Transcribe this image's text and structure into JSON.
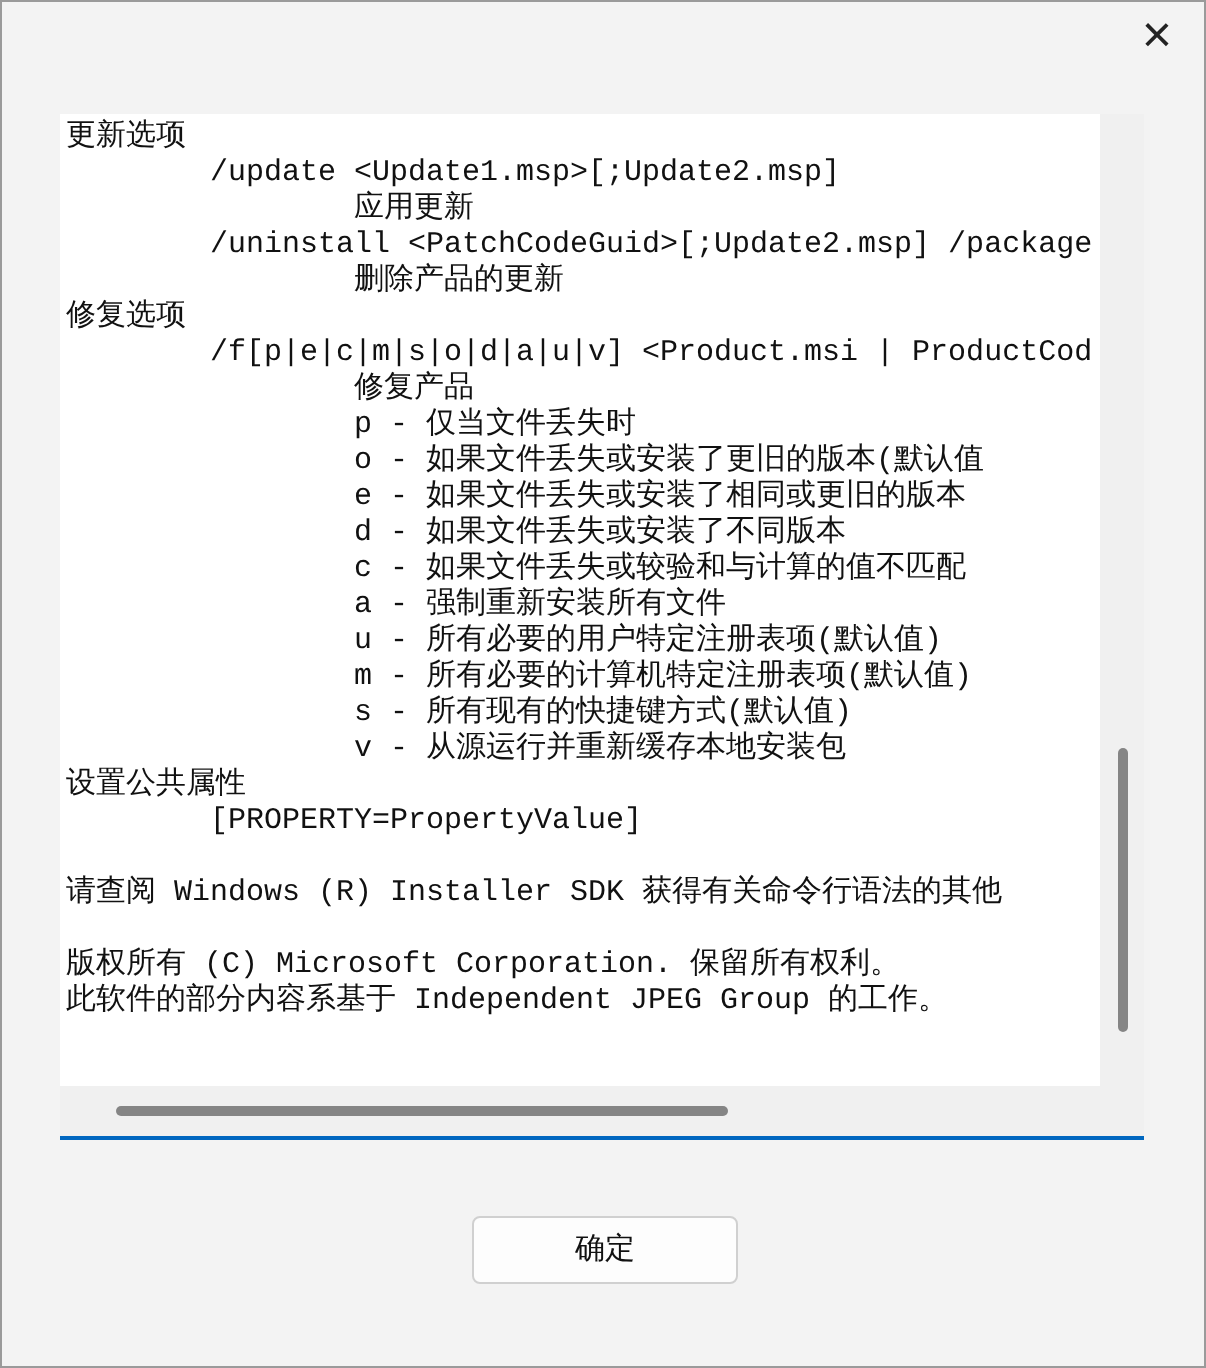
{
  "paragraphs": [
    [
      {
        "text": "更新选项",
        "children": [
          {
            "text": "/update <Update1.msp>[;Update2.msp]",
            "children": [
              {
                "text": "应用更新"
              }
            ]
          },
          {
            "text": "/uninstall <PatchCodeGuid>[;Update2.msp] /package",
            "children": [
              {
                "text": "删除产品的更新"
              }
            ]
          }
        ]
      },
      {
        "text": "修复选项",
        "children": [
          {
            "text": "/f[p|e|c|m|s|o|d|a|u|v] <Product.msi | ProductCod",
            "children": [
              {
                "text": "修复产品"
              },
              {
                "text": "p - 仅当文件丢失时"
              },
              {
                "text": "o - 如果文件丢失或安装了更旧的版本(默认值"
              },
              {
                "text": "e - 如果文件丢失或安装了相同或更旧的版本"
              },
              {
                "text": "d - 如果文件丢失或安装了不同版本"
              },
              {
                "text": "c - 如果文件丢失或较验和与计算的值不匹配"
              },
              {
                "text": "a - 强制重新安装所有文件"
              },
              {
                "text": "u - 所有必要的用户特定注册表项(默认值)"
              },
              {
                "text": "m - 所有必要的计算机特定注册表项(默认值)"
              },
              {
                "text": "s - 所有现有的快捷键方式(默认值)"
              },
              {
                "text": "v - 从源运行并重新缓存本地安装包"
              }
            ]
          }
        ]
      },
      {
        "text": "设置公共属性",
        "children": [
          {
            "text": "[PROPERTY=PropertyValue]"
          }
        ]
      }
    ],
    [
      {
        "text": "请查阅 Windows (R) Installer SDK 获得有关命令行语法的其他"
      }
    ],
    [
      {
        "text": "版权所有 (C) Microsoft Corporation. 保留所有权利。"
      },
      {
        "text": "此软件的部分内容系基于 Independent JPEG Group 的工作。"
      }
    ]
  ],
  "close": "×",
  "button": "确定"
}
